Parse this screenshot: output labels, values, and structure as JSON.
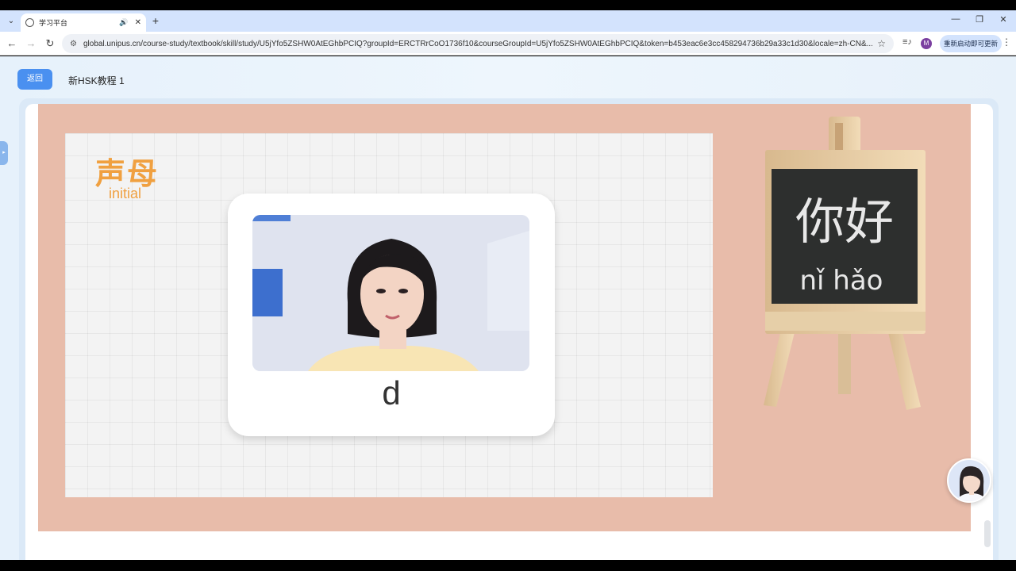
{
  "browser": {
    "tab_title": "学习平台",
    "url": "global.unipus.cn/course-study/textbook/skill/study/U5jYfo5ZSHW0AtEGhbPCIQ?groupId=ERCTRrCoO1736f10&courseGroupId=U5jYfo5ZSHW0AtEGhbPCIQ&token=b453eac6e3cc458294736b29a33c1d30&locale=zh-CN&...",
    "profile_initial": "M",
    "update_label": "重新启动即可更新"
  },
  "page": {
    "back_label": "返回",
    "course_title": "新HSK教程 1"
  },
  "slide": {
    "initial_zh": "声母",
    "initial_en": "initial",
    "letter": "d",
    "easel_hanzi": "你好",
    "easel_pinyin": "nǐ hǎo"
  },
  "colors": {
    "slide_bg": "#e8bcaa",
    "accent_orange": "#f0a040",
    "button_blue": "#4a90f0"
  }
}
